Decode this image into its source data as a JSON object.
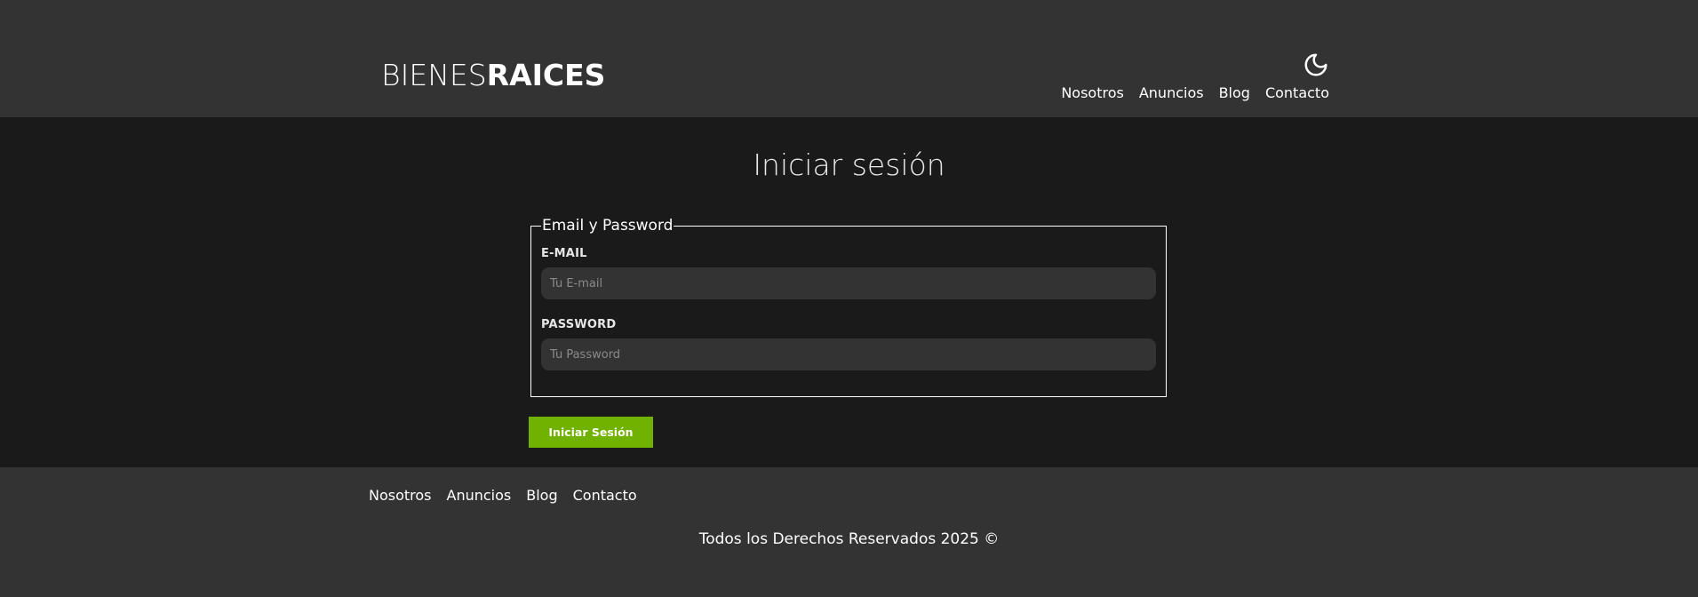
{
  "header": {
    "logo_light": "BIENES",
    "logo_bold": "RAICES",
    "dark_mode_icon": "moon-icon",
    "nav": [
      {
        "label": "Nosotros"
      },
      {
        "label": "Anuncios"
      },
      {
        "label": "Blog"
      },
      {
        "label": "Contacto"
      }
    ]
  },
  "main": {
    "title": "Iniciar sesión",
    "fieldset": {
      "legend": "Email y Password",
      "email_label": "E-MAIL",
      "email_placeholder": "Tu E-mail",
      "email_value": "",
      "password_label": "PASSWORD",
      "password_placeholder": "Tu Password",
      "password_value": ""
    },
    "submit_label": "Iniciar Sesión"
  },
  "footer": {
    "nav": [
      {
        "label": "Nosotros"
      },
      {
        "label": "Anuncios"
      },
      {
        "label": "Blog"
      },
      {
        "label": "Contacto"
      }
    ],
    "copyright": "Todos los Derechos Reservados 2025 ©"
  },
  "colors": {
    "header_bg": "#333333",
    "main_bg": "#1a1a1a",
    "accent_green": "#71b100",
    "input_bg": "#333333",
    "text": "#ffffff"
  }
}
